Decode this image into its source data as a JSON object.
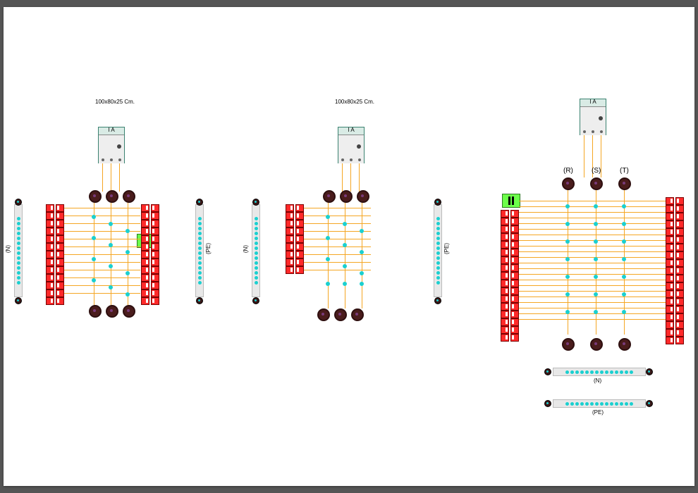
{
  "panel1": {
    "title": "100x80x25 Cm.",
    "breaker_label": "I A",
    "n_label": "(N)",
    "pe_label": "(PE)"
  },
  "panel2": {
    "title": "100x80x25 Cm.",
    "breaker_label": "I A",
    "n_label": "(N)",
    "pe_label": "(PE)"
  },
  "panel3": {
    "breaker_label": "I A",
    "phases": [
      "(R)",
      "(S)",
      "(T)"
    ],
    "n_label": "(N)",
    "pe_label": "(PE)"
  }
}
